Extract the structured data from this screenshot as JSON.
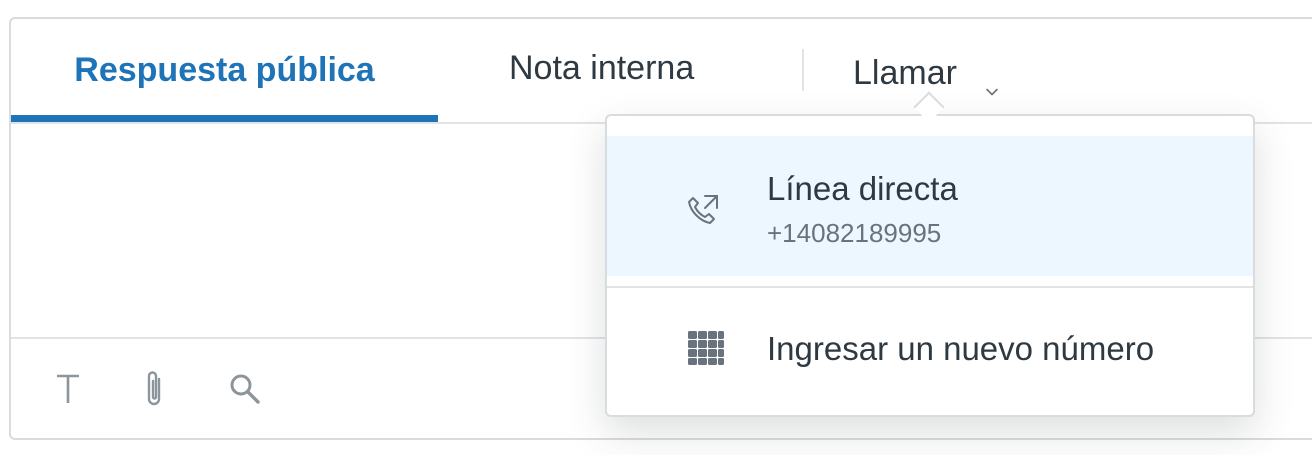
{
  "tabs": {
    "public_reply": "Respuesta pública",
    "internal_note": "Nota interna",
    "call": "Llamar"
  },
  "call_menu": {
    "direct_line": {
      "label": "Línea directa",
      "number": "+14082189995",
      "icon": "phone-icon"
    },
    "new_number": {
      "label": "Ingresar un nuevo número",
      "icon": "keypad-icon"
    }
  },
  "toolbar": {
    "text_icon": "text-format-icon",
    "attach_icon": "paperclip-icon",
    "search_icon": "search-icon"
  },
  "colors": {
    "accent": "#1f73b7",
    "highlight": "#edf7ff",
    "text": "#2f3941",
    "muted": "#68737d",
    "border": "#d8dcde"
  }
}
